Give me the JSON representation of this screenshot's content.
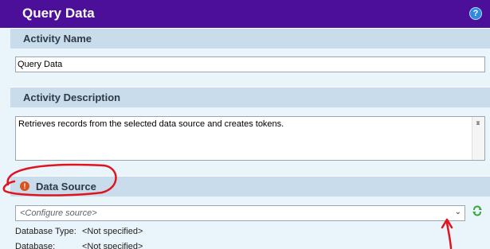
{
  "header": {
    "title": "Query Data",
    "help_icon": "?"
  },
  "activity_name": {
    "label": "Activity Name",
    "value": "Query Data"
  },
  "activity_description": {
    "label": "Activity Description",
    "value": "Retrieves records from the selected data source and creates tokens."
  },
  "data_source": {
    "label": "Data Source",
    "warning_icon": "!",
    "source_placeholder": "<Configure source>",
    "database_type_label": "Database Type:",
    "database_type_value": "<Not specified>",
    "database_label": "Database:",
    "database_value": "<Not specified>"
  },
  "colors": {
    "title_bar": "#4b0f99",
    "section_bg": "#c9dceb",
    "body_bg": "#eaf4fb",
    "annotation": "#e0141e",
    "warning": "#d9541f"
  },
  "icons": [
    "help-icon",
    "warning-icon",
    "chevron-down-icon",
    "refresh-icon",
    "scroll-up-icon",
    "scroll-down-icon"
  ]
}
